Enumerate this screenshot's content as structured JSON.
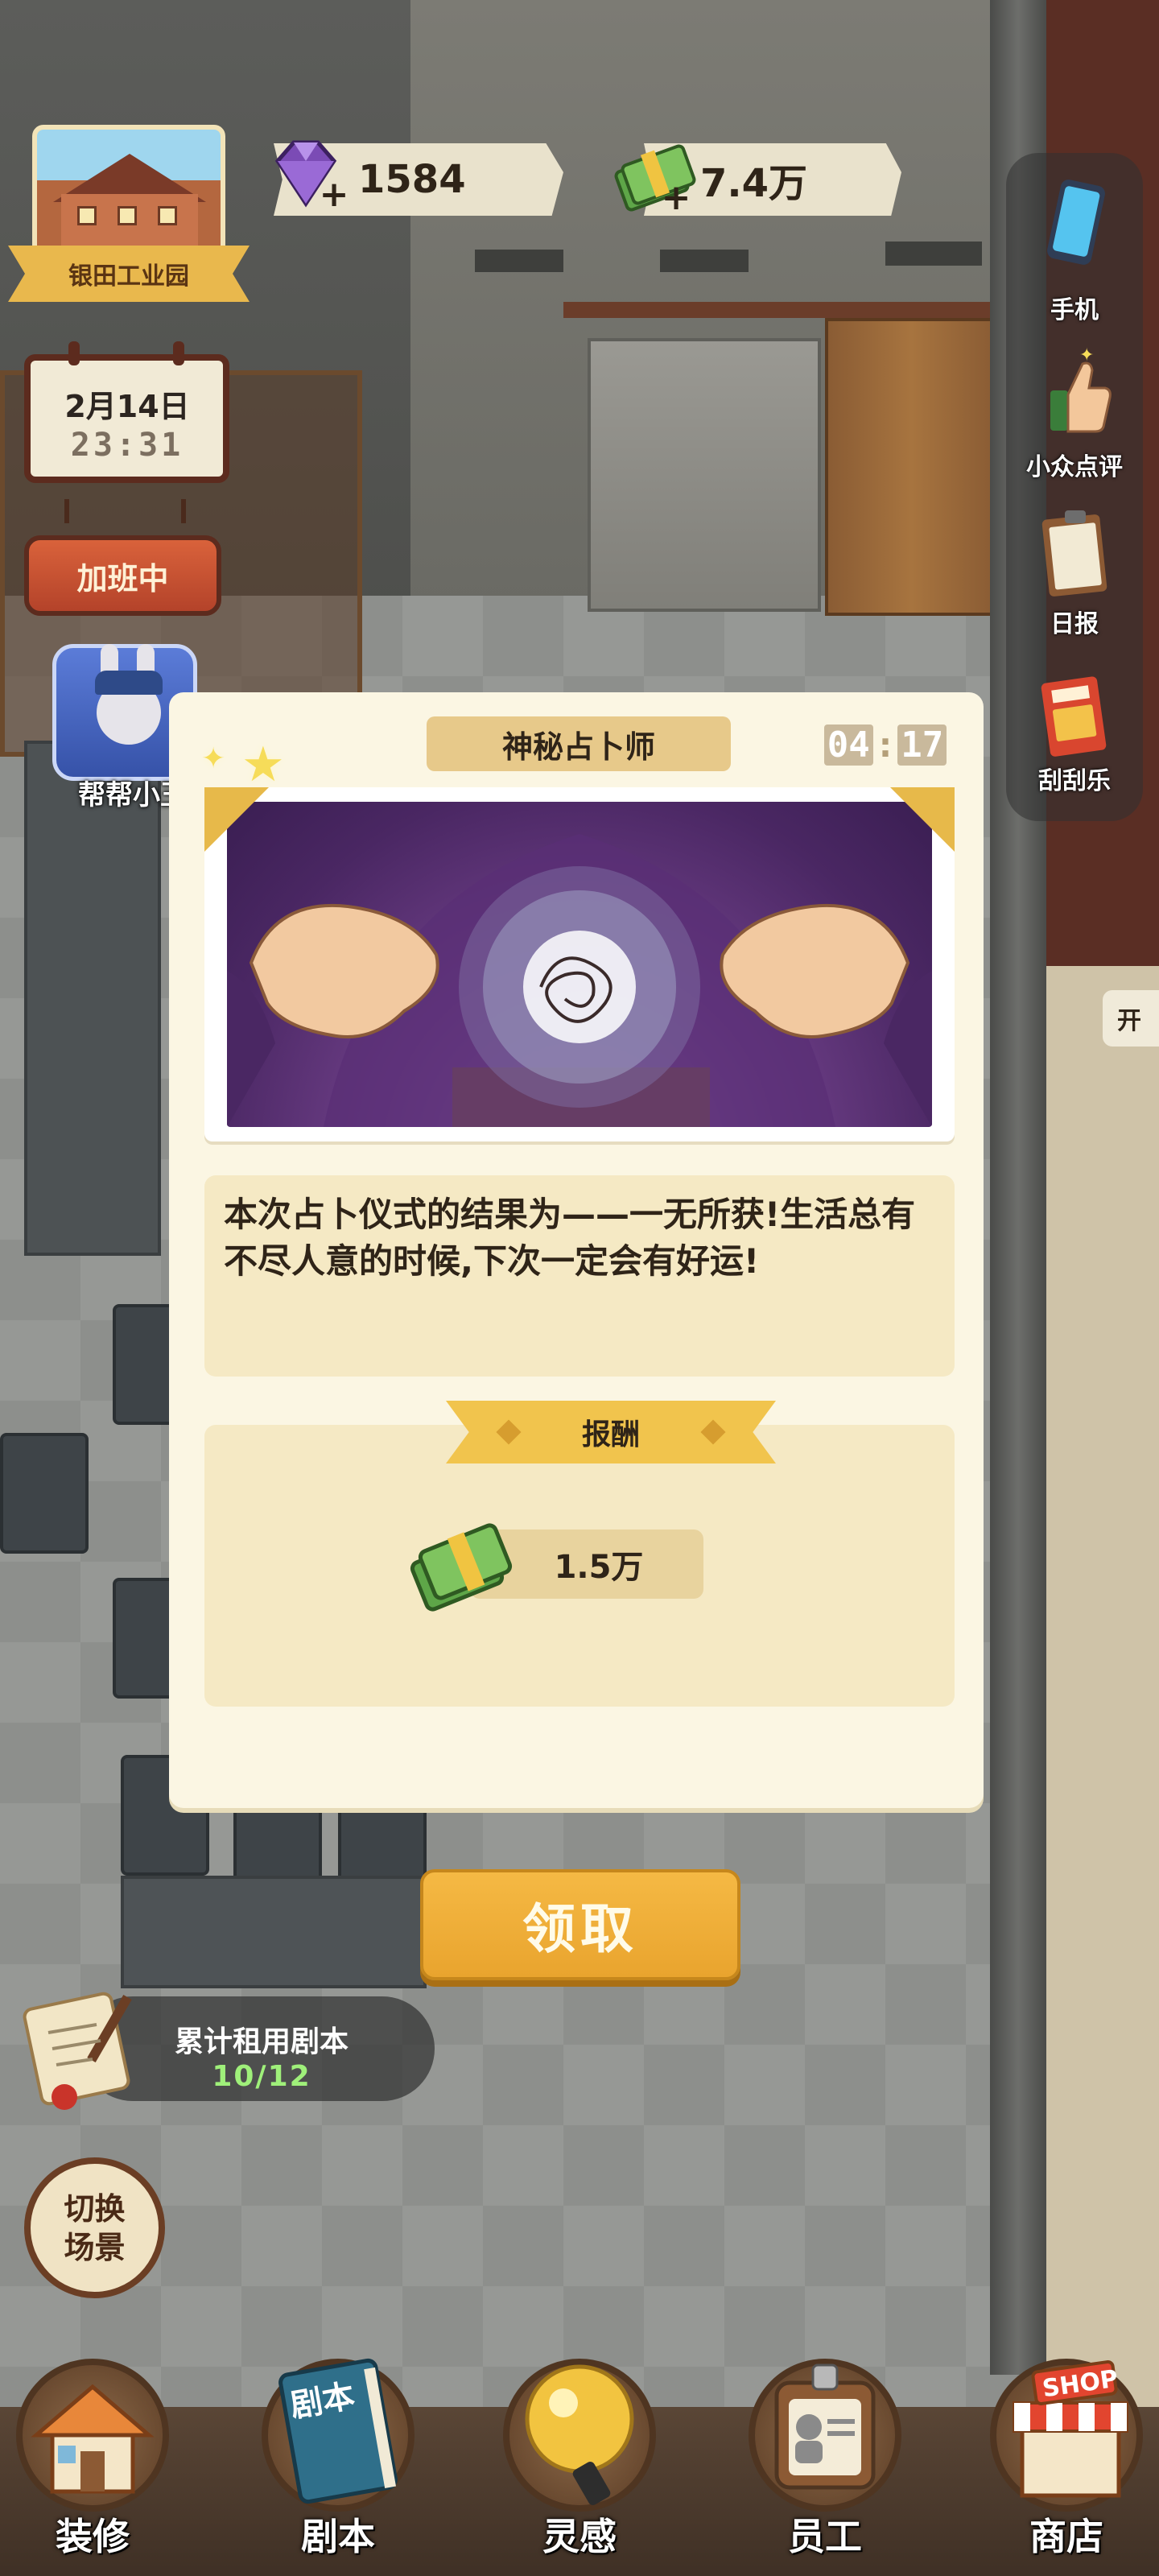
{
  "hud": {
    "location_name": "银田工业园",
    "gems": "1584",
    "cash": "7.4万",
    "date": "2月14日",
    "time": "23:31",
    "overtime_label": "加班中",
    "helper_label": "帮帮小玉"
  },
  "sidebar": {
    "items": [
      {
        "label": "手机",
        "icon": "phone-icon"
      },
      {
        "label": "小众点评",
        "icon": "thumbs-up-icon"
      },
      {
        "label": "日报",
        "icon": "clipboard-icon"
      },
      {
        "label": "刮刮乐",
        "icon": "scratch-card-icon"
      }
    ]
  },
  "side_tag": "开",
  "dialog": {
    "title": "神秘占卜师",
    "timer_min": "04",
    "timer_sec": "17",
    "result_text": "本次占卜仪式的结果为——一无所获!生活总有不尽人意的时候,下次一定会有好运!",
    "reward_title": "报酬",
    "reward_amount": "1.5万",
    "claim_label": "领取"
  },
  "script_counter": {
    "label": "累计租用剧本",
    "value": "10/12"
  },
  "switch_scene": {
    "line1": "切换",
    "line2": "场景"
  },
  "bottom_nav": {
    "items": [
      {
        "label": "装修",
        "icon": "house-icon"
      },
      {
        "label": "剧本",
        "icon": "script-book-icon"
      },
      {
        "label": "灵感",
        "icon": "crystal-ball-icon"
      },
      {
        "label": "员工",
        "icon": "employee-badge-icon"
      },
      {
        "label": "商店",
        "icon": "shop-icon"
      }
    ],
    "book_title": "剧本",
    "shop_sign": "SHOP"
  },
  "colors": {
    "accent_gold": "#f1c44d",
    "dialog_bg": "#fbf6e3",
    "panel_bg": "#f5e9c4",
    "claim_button": "#f5b944",
    "counter_green": "#9ff07a"
  }
}
